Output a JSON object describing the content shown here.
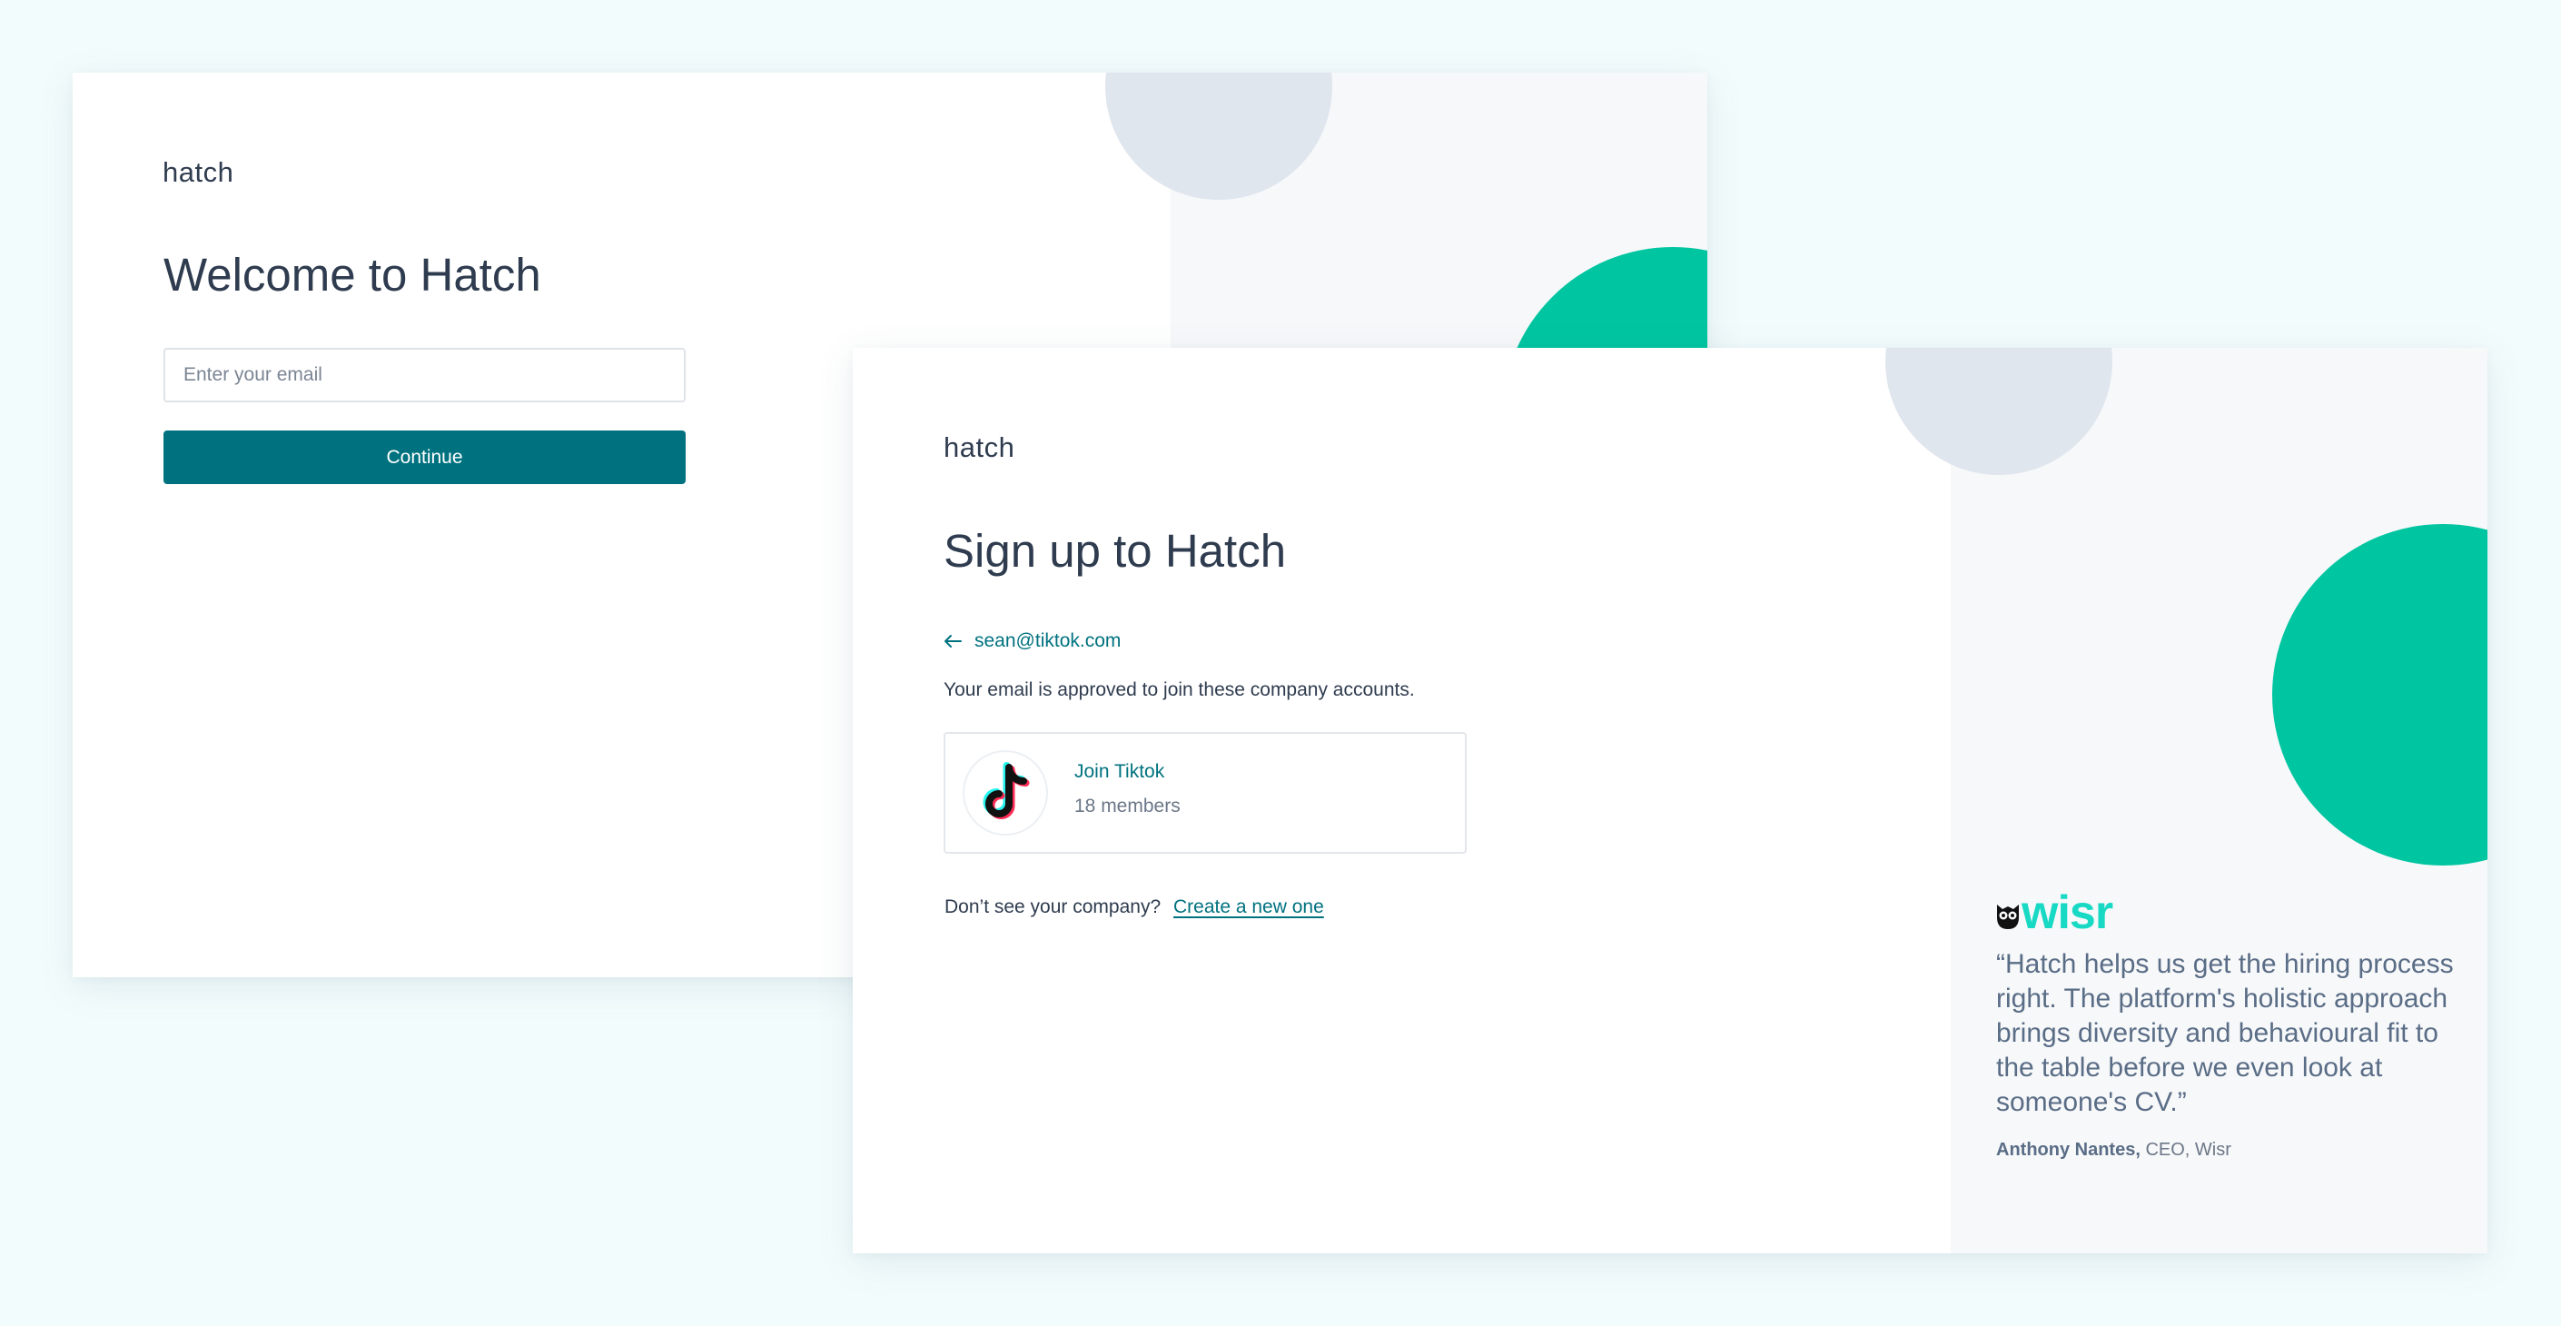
{
  "colors": {
    "background": "#f3fcfd",
    "primary_teal": "#00727f",
    "accent_green": "#00c5a1",
    "circle_grey": "#e0e6ee",
    "panel_grey": "#f7f8fa",
    "text_dark": "#2f3c4f",
    "wisr_brand": "#17d9c4"
  },
  "welcome": {
    "logo": "hatch",
    "title": "Welcome to Hatch",
    "email_placeholder": "Enter your email",
    "continue_label": "Continue"
  },
  "signup": {
    "logo": "hatch",
    "title": "Sign up to Hatch",
    "back_icon": "arrow-left-icon",
    "email": "sean@tiktok.com",
    "approved_text": "Your email is approved to join these company accounts.",
    "companies": [
      {
        "icon": "tiktok-logo-icon",
        "join_label": "Join Tiktok",
        "members": "18 members"
      }
    ],
    "missing_prompt": "Don’t see your company?",
    "create_link": "Create a new one"
  },
  "testimonial": {
    "brand_icon": "owl-icon",
    "brand": "wisr",
    "quote": "“Hatch helps us get the hiring process right. The platform's holistic approach brings diversity and behavioural fit to the table before we even look at someone's CV.”",
    "author": "Anthony Nantes,",
    "author_role": "CEO, Wisr"
  }
}
